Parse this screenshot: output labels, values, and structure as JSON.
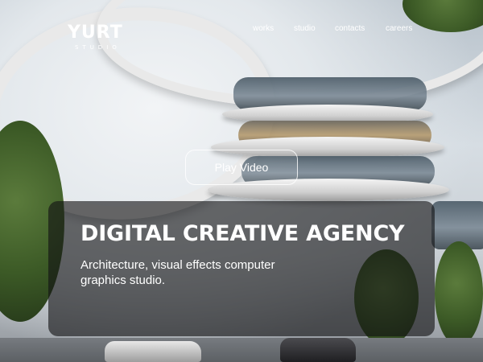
{
  "logo": {
    "name": "YURT",
    "sub": "STUDIO"
  },
  "nav": {
    "items": [
      "works",
      "studio",
      "contacts",
      "careers"
    ]
  },
  "hero": {
    "play_label": "Play Video",
    "title": "DIGITAL CREATIVE AGENCY",
    "subtitle": "Architecture, visual effects computer graphics studio."
  },
  "background": {
    "subject": "architectural-render-curved-building"
  }
}
